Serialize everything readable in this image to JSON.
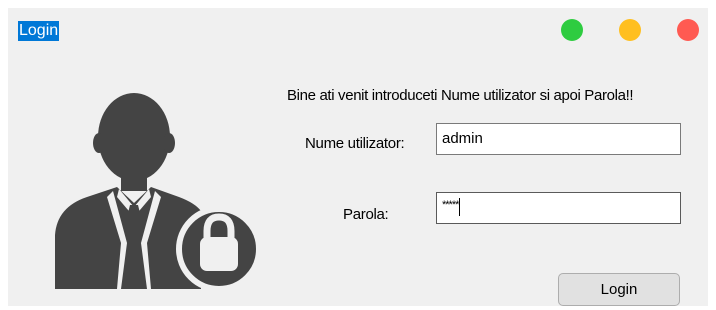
{
  "window": {
    "title": "Login",
    "controls": [
      {
        "name": "green",
        "color": "#2ecc40"
      },
      {
        "name": "yellow",
        "color": "#ffbf1f"
      },
      {
        "name": "red",
        "color": "#ff5a52"
      }
    ]
  },
  "avatar": {
    "icon": "user-lock-icon",
    "color": "#444444"
  },
  "form": {
    "welcome": "Bine ati venit introduceti Nume utilizator si apoi Parola!!",
    "username_label": "Nume utilizator:",
    "username_value": "admin",
    "password_label": "Parola:",
    "password_value": "*****",
    "login_button": "Login"
  },
  "colors": {
    "title_highlight": "#0078d7",
    "window_bg": "#f0f0f0"
  }
}
